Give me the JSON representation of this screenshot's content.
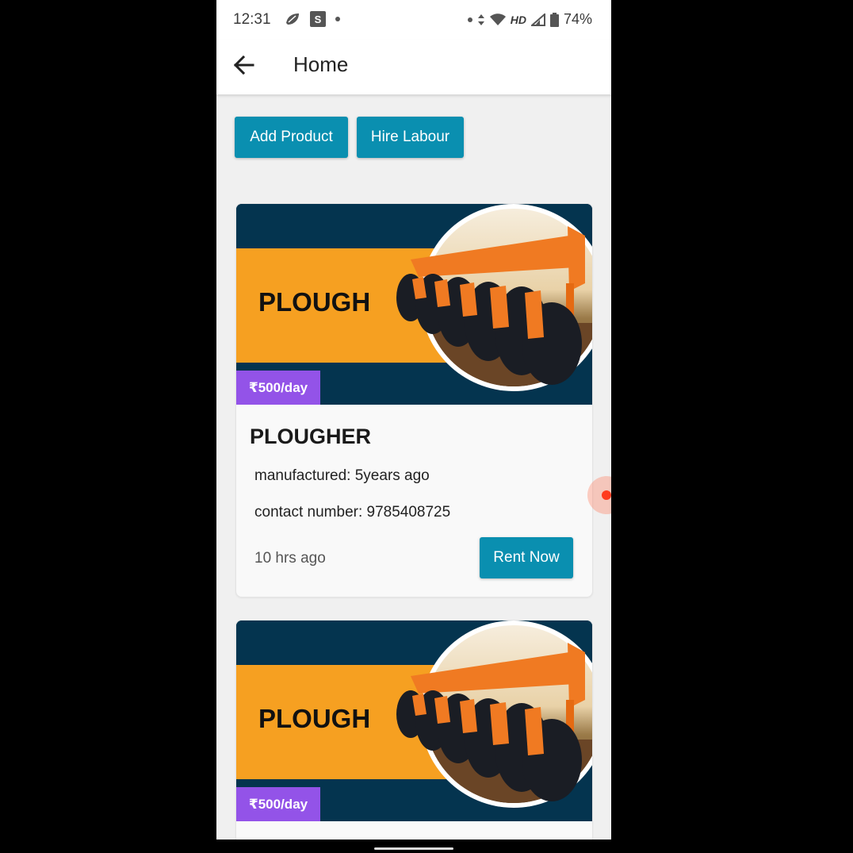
{
  "status_bar": {
    "time": "12:31",
    "network": "HD",
    "battery": "74%",
    "icons": [
      "leaf-icon",
      "s-app-icon",
      "dot-icon",
      "data-arrows-icon",
      "wifi-icon",
      "signal-icon",
      "battery-icon"
    ]
  },
  "app_bar": {
    "back_icon": "arrow-left-icon",
    "title": "Home"
  },
  "actions": {
    "add_product": "Add Product",
    "hire_labour": "Hire Labour"
  },
  "products": [
    {
      "banner_text": "PLOUGH",
      "price": "₹500/day",
      "title": "PLOUGHER",
      "manufactured": "manufactured: 5years ago",
      "contact": "contact number: 9785408725",
      "posted": "10 hrs ago",
      "action": "Rent Now"
    },
    {
      "banner_text": "PLOUGH",
      "price": "₹500/day"
    }
  ],
  "colors": {
    "accent": "#0a8fb0",
    "price_badge": "#9353e8",
    "banner_navy": "#04344f",
    "banner_orange": "#f6a021",
    "plough_orange": "#f07a22"
  }
}
